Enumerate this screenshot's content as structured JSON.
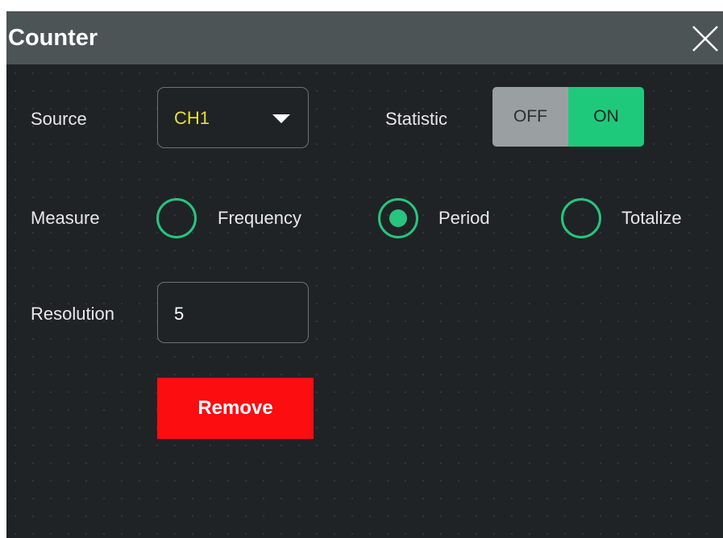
{
  "dialog": {
    "title": "Counter",
    "close_icon": "close-icon"
  },
  "source": {
    "label": "Source",
    "value": "CH1",
    "dropdown_icon": "caret-down-icon",
    "value_color": "#e6dd3e"
  },
  "statistic": {
    "label": "Statistic",
    "off_label": "OFF",
    "on_label": "ON",
    "selected": "ON",
    "on_color": "#1fc97c"
  },
  "measure": {
    "label": "Measure",
    "options": [
      "Frequency",
      "Period",
      "Totalize"
    ],
    "selected": "Period",
    "accent_color": "#27c57e"
  },
  "resolution": {
    "label": "Resolution",
    "value": "5"
  },
  "remove_button": {
    "label": "Remove",
    "color": "#fb0d10"
  }
}
